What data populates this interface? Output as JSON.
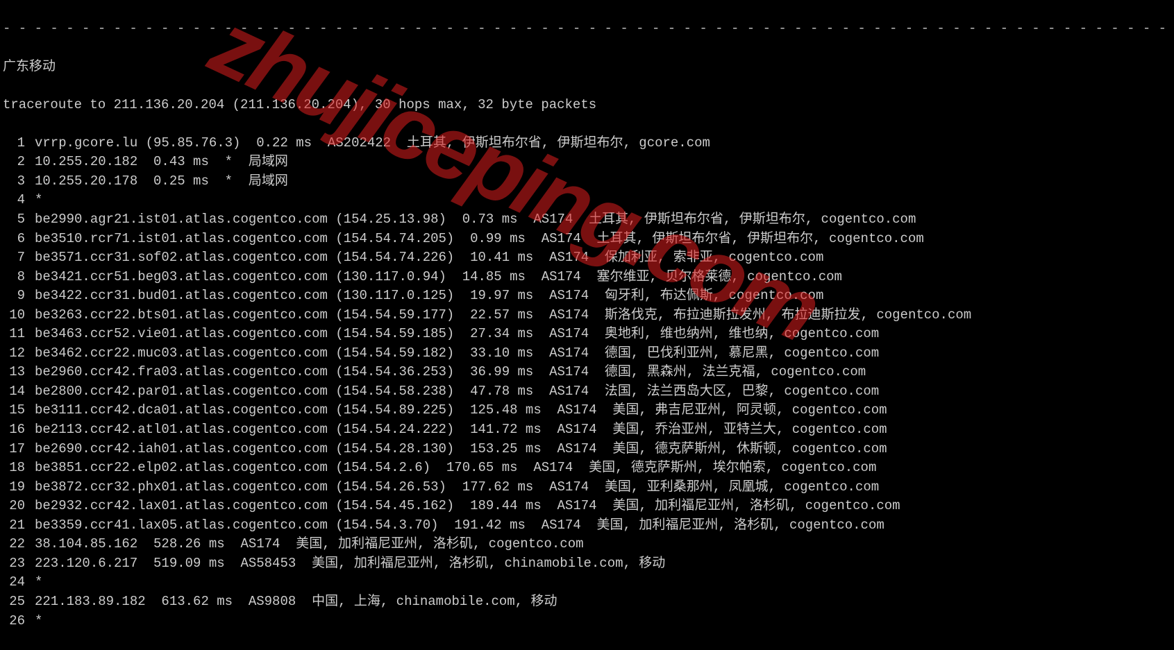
{
  "separator": "- - - - - - - - - - - - - - - - - - - - - - - - - - - - - - - - - - - - - - - - - - - - - - - - - - - - - - - - - - - - - - - - - - - - - - - - - - - - - -",
  "title": "广东移动",
  "header": "traceroute to 211.136.20.204 (211.136.20.204), 30 hops max, 32 byte packets",
  "watermark": "zhujiceping.com",
  "hops": [
    {
      "num": "1",
      "text": "vrrp.gcore.lu (95.85.76.3)  0.22 ms  AS202422  土耳其, 伊斯坦布尔省, 伊斯坦布尔, gcore.com"
    },
    {
      "num": "2",
      "text": "10.255.20.182  0.43 ms  *  局域网"
    },
    {
      "num": "3",
      "text": "10.255.20.178  0.25 ms  *  局域网"
    },
    {
      "num": "4",
      "text": "*"
    },
    {
      "num": "5",
      "text": "be2990.agr21.ist01.atlas.cogentco.com (154.25.13.98)  0.73 ms  AS174  土耳其, 伊斯坦布尔省, 伊斯坦布尔, cogentco.com"
    },
    {
      "num": "6",
      "text": "be3510.rcr71.ist01.atlas.cogentco.com (154.54.74.205)  0.99 ms  AS174  土耳其, 伊斯坦布尔省, 伊斯坦布尔, cogentco.com"
    },
    {
      "num": "7",
      "text": "be3571.ccr31.sof02.atlas.cogentco.com (154.54.74.226)  10.41 ms  AS174  保加利亚, 索非亚, cogentco.com"
    },
    {
      "num": "8",
      "text": "be3421.ccr51.beg03.atlas.cogentco.com (130.117.0.94)  14.85 ms  AS174  塞尔维亚, 贝尔格莱德, cogentco.com"
    },
    {
      "num": "9",
      "text": "be3422.ccr31.bud01.atlas.cogentco.com (130.117.0.125)  19.97 ms  AS174  匈牙利, 布达佩斯, cogentco.com"
    },
    {
      "num": "10",
      "text": "be3263.ccr22.bts01.atlas.cogentco.com (154.54.59.177)  22.57 ms  AS174  斯洛伐克, 布拉迪斯拉发州, 布拉迪斯拉发, cogentco.com"
    },
    {
      "num": "11",
      "text": "be3463.ccr52.vie01.atlas.cogentco.com (154.54.59.185)  27.34 ms  AS174  奥地利, 维也纳州, 维也纳, cogentco.com"
    },
    {
      "num": "12",
      "text": "be3462.ccr22.muc03.atlas.cogentco.com (154.54.59.182)  33.10 ms  AS174  德国, 巴伐利亚州, 慕尼黑, cogentco.com"
    },
    {
      "num": "13",
      "text": "be2960.ccr42.fra03.atlas.cogentco.com (154.54.36.253)  36.99 ms  AS174  德国, 黑森州, 法兰克福, cogentco.com"
    },
    {
      "num": "14",
      "text": "be2800.ccr42.par01.atlas.cogentco.com (154.54.58.238)  47.78 ms  AS174  法国, 法兰西岛大区, 巴黎, cogentco.com"
    },
    {
      "num": "15",
      "text": "be3111.ccr42.dca01.atlas.cogentco.com (154.54.89.225)  125.48 ms  AS174  美国, 弗吉尼亚州, 阿灵顿, cogentco.com"
    },
    {
      "num": "16",
      "text": "be2113.ccr42.atl01.atlas.cogentco.com (154.54.24.222)  141.72 ms  AS174  美国, 乔治亚州, 亚特兰大, cogentco.com"
    },
    {
      "num": "17",
      "text": "be2690.ccr42.iah01.atlas.cogentco.com (154.54.28.130)  153.25 ms  AS174  美国, 德克萨斯州, 休斯顿, cogentco.com"
    },
    {
      "num": "18",
      "text": "be3851.ccr22.elp02.atlas.cogentco.com (154.54.2.6)  170.65 ms  AS174  美国, 德克萨斯州, 埃尔帕索, cogentco.com"
    },
    {
      "num": "19",
      "text": "be3872.ccr32.phx01.atlas.cogentco.com (154.54.26.53)  177.62 ms  AS174  美国, 亚利桑那州, 凤凰城, cogentco.com"
    },
    {
      "num": "20",
      "text": "be2932.ccr42.lax01.atlas.cogentco.com (154.54.45.162)  189.44 ms  AS174  美国, 加利福尼亚州, 洛杉矶, cogentco.com"
    },
    {
      "num": "21",
      "text": "be3359.ccr41.lax05.atlas.cogentco.com (154.54.3.70)  191.42 ms  AS174  美国, 加利福尼亚州, 洛杉矶, cogentco.com"
    },
    {
      "num": "22",
      "text": "38.104.85.162  528.26 ms  AS174  美国, 加利福尼亚州, 洛杉矶, cogentco.com"
    },
    {
      "num": "23",
      "text": "223.120.6.217  519.09 ms  AS58453  美国, 加利福尼亚州, 洛杉矶, chinamobile.com, 移动"
    },
    {
      "num": "24",
      "text": "*"
    },
    {
      "num": "25",
      "text": "221.183.89.182  613.62 ms  AS9808  中国, 上海, chinamobile.com, 移动"
    },
    {
      "num": "26",
      "text": "*"
    }
  ]
}
